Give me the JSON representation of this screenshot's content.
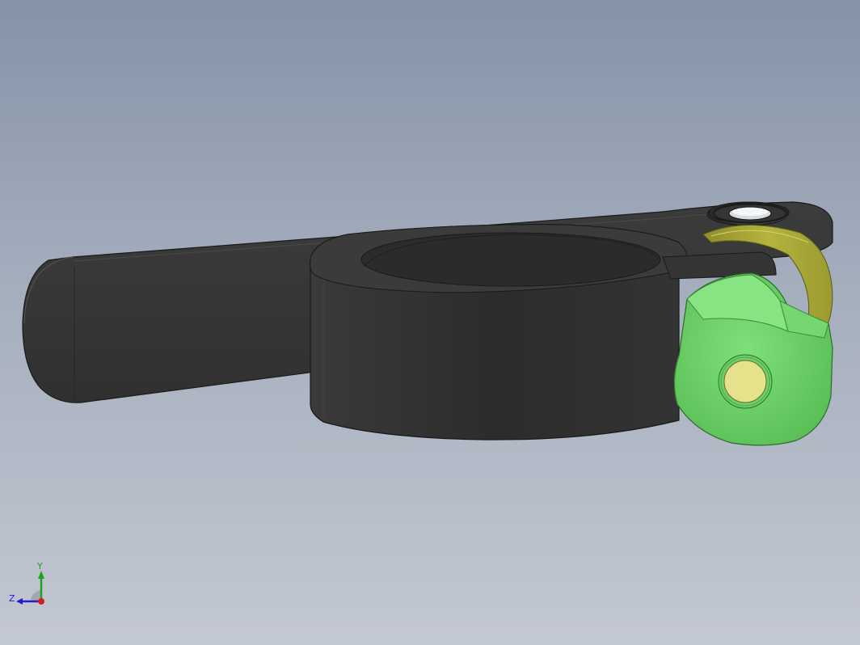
{
  "viewport": {
    "background_top": "#8593a8",
    "background_bottom": "#c3c8d2"
  },
  "model": {
    "parts": [
      "clamp-band",
      "quick-release-lever",
      "cam-nut",
      "washer"
    ],
    "colors": {
      "clamp_body": "#2f2f2f",
      "cam_nut": "#6ed46a",
      "cam_nut_face": "#e6e28c",
      "washer": "#a4a437"
    }
  },
  "triad": {
    "y_label": "Y",
    "z_label": "Z",
    "y_color": "#20a020",
    "z_color": "#2020c8",
    "x_color": "#d02020"
  }
}
